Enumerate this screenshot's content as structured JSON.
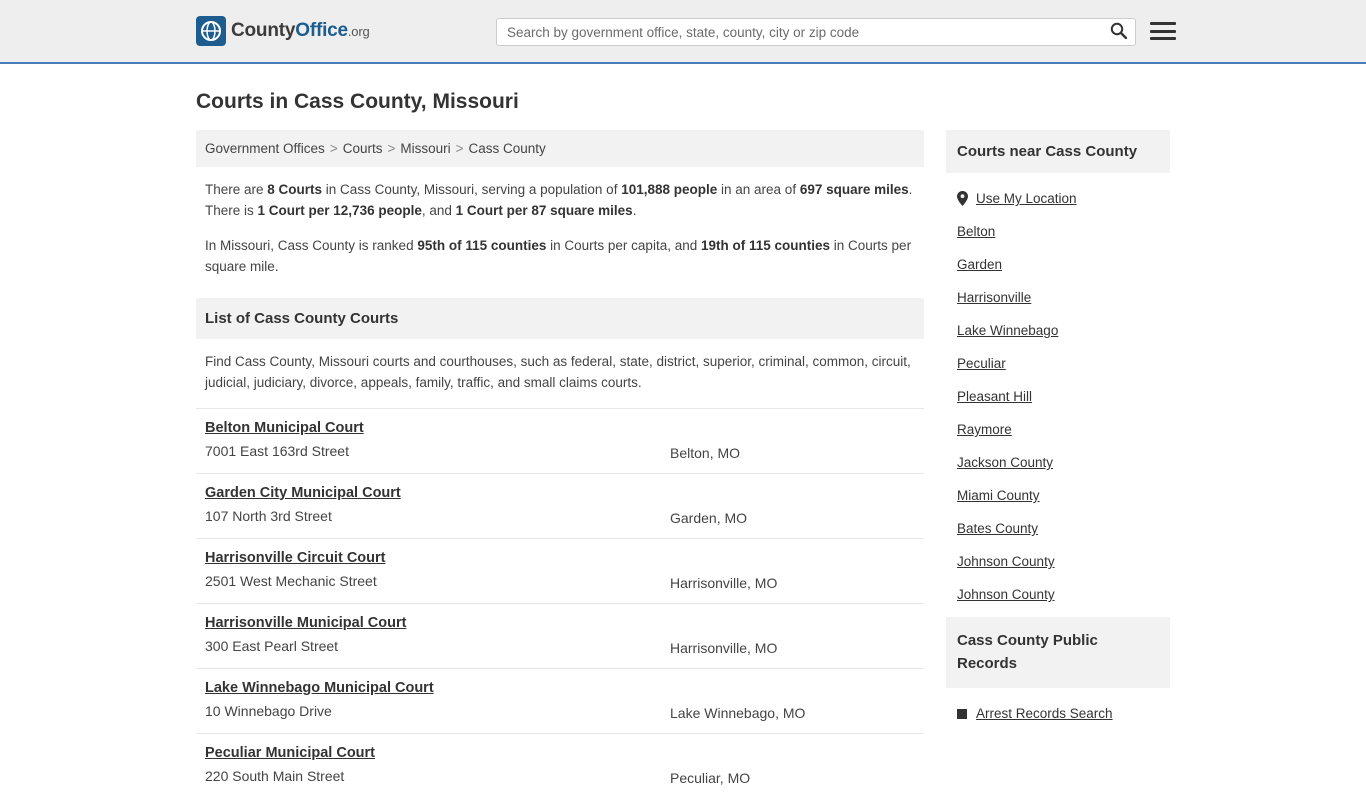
{
  "header": {
    "logo": {
      "part1": "County",
      "part2": "Office",
      "part3": ".org",
      "icon": "globe-icon"
    },
    "search": {
      "placeholder": "Search by government office, state, county, city or zip code",
      "value": "",
      "button_icon": "search-icon"
    },
    "menu_icon": "hamburger-menu-icon"
  },
  "page": {
    "title": "Courts in Cass County, Missouri"
  },
  "breadcrumb": {
    "items": [
      {
        "label": "Government Offices"
      },
      {
        "label": "Courts"
      },
      {
        "label": "Missouri"
      },
      {
        "label": "Cass County"
      }
    ],
    "separator": ">"
  },
  "intro": {
    "p1_parts": [
      "There are ",
      "8 Courts",
      " in Cass County, Missouri, serving a population of ",
      "101,888 people",
      " in an area of ",
      "697 square miles",
      ". There is ",
      "1 Court per 12,736 people",
      ", and ",
      "1 Court per 87 square miles",
      "."
    ],
    "p2_parts": [
      "In Missouri, Cass County is ranked ",
      "95th of 115 counties",
      " in Courts per capita, and ",
      "19th of 115 counties",
      " in Courts per square mile."
    ]
  },
  "list_section": {
    "heading": "List of Cass County Courts",
    "description": "Find Cass County, Missouri courts and courthouses, such as federal, state, district, superior, criminal, common, circuit, judicial, judiciary, divorce, appeals, family, traffic, and small claims courts."
  },
  "courts": [
    {
      "name": "Belton Municipal Court",
      "address": "7001 East 163rd Street",
      "city": "Belton, MO"
    },
    {
      "name": "Garden City Municipal Court",
      "address": "107 North 3rd Street",
      "city": "Garden, MO"
    },
    {
      "name": "Harrisonville Circuit Court",
      "address": "2501 West Mechanic Street",
      "city": "Harrisonville, MO"
    },
    {
      "name": "Harrisonville Municipal Court",
      "address": "300 East Pearl Street",
      "city": "Harrisonville, MO"
    },
    {
      "name": "Lake Winnebago Municipal Court",
      "address": "10 Winnebago Drive",
      "city": "Lake Winnebago, MO"
    },
    {
      "name": "Peculiar Municipal Court",
      "address": "220 South Main Street",
      "city": "Peculiar, MO"
    }
  ],
  "sidebar": {
    "nearby": {
      "heading": "Courts near Cass County",
      "use_my_location": {
        "label": "Use My Location",
        "icon": "map-pin-icon"
      },
      "items": [
        {
          "label": "Belton"
        },
        {
          "label": "Garden"
        },
        {
          "label": "Harrisonville"
        },
        {
          "label": "Lake Winnebago"
        },
        {
          "label": "Peculiar"
        },
        {
          "label": "Pleasant Hill"
        },
        {
          "label": "Raymore"
        },
        {
          "label": "Jackson County"
        },
        {
          "label": "Miami County"
        },
        {
          "label": "Bates County"
        },
        {
          "label": "Johnson County"
        },
        {
          "label": "Johnson County"
        }
      ]
    },
    "public_records": {
      "heading": "Cass County Public Records",
      "items": [
        {
          "label": "Arrest Records Search",
          "icon": "square-bullet-icon"
        }
      ]
    }
  }
}
